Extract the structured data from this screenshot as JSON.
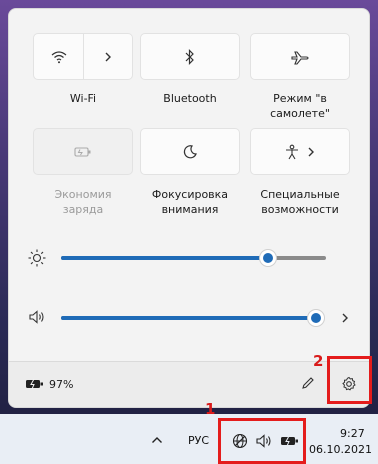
{
  "quick_settings": {
    "tiles": [
      {
        "id": "wifi",
        "label": "Wi-Fi",
        "icon": "wifi-icon",
        "state": "active"
      },
      {
        "id": "bluetooth",
        "label": "Bluetooth",
        "icon": "bluetooth-icon",
        "state": "normal"
      },
      {
        "id": "airplane",
        "label": "Режим \"в самолете\"",
        "icon": "airplane-icon",
        "state": "normal"
      },
      {
        "id": "battery_saver",
        "label": "Экономия заряда",
        "icon": "battery-saver-icon",
        "state": "disabled"
      },
      {
        "id": "focus",
        "label": "Фокусировка внимания",
        "icon": "moon-icon",
        "state": "normal"
      },
      {
        "id": "accessibility",
        "label": "Специальные возможности",
        "icon": "accessibility-icon",
        "state": "normal"
      }
    ],
    "brightness": {
      "icon": "brightness-icon",
      "level": 0.78
    },
    "volume": {
      "icon": "speaker-icon",
      "level": 1.0
    }
  },
  "footer": {
    "battery_text": "97%",
    "battery_icon": "battery-charging-icon",
    "edit_icon": "pencil-icon",
    "settings_icon": "gear-icon"
  },
  "annotations": {
    "label1": "1",
    "label2": "2"
  },
  "taskbar": {
    "language": "РУС",
    "time": "9:27",
    "date": "06.10.2021",
    "icons": [
      "chevron-up-icon",
      "globe-icon",
      "speaker-icon",
      "battery-charging-icon"
    ]
  },
  "colors": {
    "accent": "#1f6bb7",
    "annotation": "#e41c1c"
  }
}
